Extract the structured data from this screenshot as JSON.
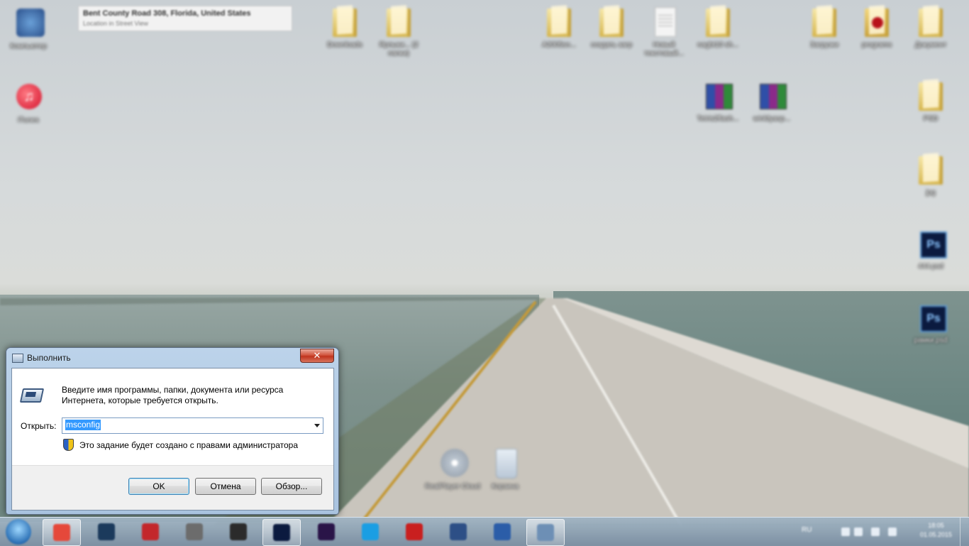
{
  "location_tooltip": {
    "title": "Bent County Road 308, Florida, United States",
    "subtitle": "Location in Street View"
  },
  "desktop_icons": [
    {
      "name": "computer",
      "label": "Компьютер",
      "icon": "computer-icon"
    },
    {
      "name": "itunes",
      "label": "iTunes",
      "icon": "itunes-icon"
    },
    {
      "name": "folder-1",
      "label": "Downloads",
      "icon": "folder-icon"
    },
    {
      "name": "folder-2",
      "label": "Ярлыки... (2 папки)",
      "icon": "folder-icon"
    },
    {
      "name": "folder-3",
      "label": "A2005sn...",
      "icon": "folder-icon"
    },
    {
      "name": "folder-4",
      "label": "создать загр",
      "icon": "folder-icon"
    },
    {
      "name": "doc-1",
      "label": "Новый текстовый...",
      "icon": "document-icon"
    },
    {
      "name": "folder-5",
      "label": "nagbt10 sh...",
      "icon": "folder-icon"
    },
    {
      "name": "folder-6",
      "label": "Загрузки",
      "icon": "folder-icon"
    },
    {
      "name": "app-1",
      "label": "programs",
      "icon": "app-icon"
    },
    {
      "name": "folder-7",
      "label": "Документ",
      "icon": "folder-icon"
    },
    {
      "name": "rar-1",
      "label": "Tetris2flash...",
      "icon": "winrar-icon"
    },
    {
      "name": "rar-2",
      "label": "winldyasp...",
      "icon": "winrar-icon"
    },
    {
      "name": "folder-8",
      "label": "PSD",
      "icon": "folder-icon"
    },
    {
      "name": "folder-9",
      "label": "jpg",
      "icon": "folder-icon"
    },
    {
      "name": "ps-1",
      "label": "444.psd",
      "icon": "photoshop-icon"
    },
    {
      "name": "ps-2",
      "label": "рамки.psd",
      "icon": "photoshop-icon"
    },
    {
      "name": "media-player",
      "label": "RealPlayer Cloud",
      "icon": "disc-icon"
    },
    {
      "name": "recycle-bin",
      "label": "Корзина",
      "icon": "recycle-bin-icon"
    }
  ],
  "run_dialog": {
    "title": "Выполнить",
    "close_label": "✕",
    "description": "Введите имя программы, папки, документа или ресурса Интернета, которые требуется открыть.",
    "open_label": "Открыть:",
    "input_value": "msconfig",
    "admin_note": "Это задание будет создано с правами администратора",
    "ok_label": "OK",
    "cancel_label": "Отмена",
    "browse_label": "Обзор..."
  },
  "taskbar": {
    "buttons": [
      {
        "name": "chrome",
        "icon": "chrome-icon",
        "color": "#e5483a",
        "active": true
      },
      {
        "name": "steam",
        "icon": "steam-icon",
        "color": "#1b3a5c",
        "active": false
      },
      {
        "name": "x-app",
        "icon": "x-icon",
        "color": "#c3272b",
        "active": false
      },
      {
        "name": "settings",
        "icon": "gear-icon",
        "color": "#6c6c6c",
        "active": false
      },
      {
        "name": "film",
        "icon": "film-icon",
        "color": "#2b2b2b",
        "active": false
      },
      {
        "name": "photoshop",
        "icon": "photoshop-icon",
        "color": "#0b1a3f",
        "active": true
      },
      {
        "name": "after-effects",
        "icon": "after-effects-icon",
        "color": "#2a1448",
        "active": false
      },
      {
        "name": "skype",
        "icon": "skype-icon",
        "color": "#1a9ee3",
        "active": false
      },
      {
        "name": "filezilla",
        "icon": "filezilla-icon",
        "color": "#c91f1f",
        "active": false
      },
      {
        "name": "calendar",
        "icon": "calendar-icon",
        "color": "#2d4f86",
        "active": false
      },
      {
        "name": "word",
        "icon": "word-icon",
        "color": "#2b5da8",
        "active": false
      },
      {
        "name": "run",
        "icon": "run-icon",
        "color": "#6d8fb5",
        "active": true
      }
    ],
    "language": "RU",
    "time": "18:05",
    "date": "01.05.2015"
  }
}
